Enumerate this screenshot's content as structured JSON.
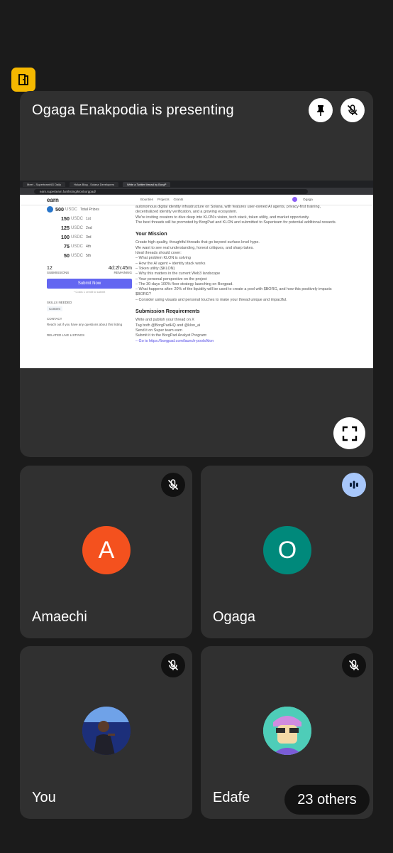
{
  "top": {
    "door_icon": "exit-door-icon",
    "door_color": "#f5b800"
  },
  "presentation": {
    "title": "Ogaga Enakpodia is presenting",
    "shared_screen": {
      "tabs": [
        "Meet - SuperteamNG Daily",
        "Holaa Blog - Solana Developers",
        "Write a Twitter thread by BorgP"
      ],
      "url": "earn.superteam.fun/listing/klonborgpad/",
      "site_logo": "earn",
      "nav_links": [
        "Bounties",
        "Projects",
        "Grants"
      ],
      "user_name": "Ogaga",
      "total_prize": "500",
      "total_prize_unit": "USDC",
      "total_prize_label": "Total Prizes",
      "prizes": [
        {
          "amount": "150",
          "unit": "USDC",
          "rank": "1st"
        },
        {
          "amount": "125",
          "unit": "USDC",
          "rank": "2nd"
        },
        {
          "amount": "100",
          "unit": "USDC",
          "rank": "3rd"
        },
        {
          "amount": "75",
          "unit": "USDC",
          "rank": "4th"
        },
        {
          "amount": "50",
          "unit": "USDC",
          "rank": "5th"
        }
      ],
      "submissions_count": "12",
      "submissions_label": "SUBMISSIONS",
      "remaining_time": "4d:2h:45m",
      "remaining_label": "REMAINING",
      "submit_label": "Submit Now",
      "credit_note": "* Costs 1 credit to submit",
      "skills_label": "SKILLS NEEDED",
      "skill": "Content",
      "contact_label": "CONTACT",
      "contact_text": "Reach out  if you have any questions about this listing",
      "related_label": "RELATED LIVE LISTINGS",
      "intro_lines": [
        "autonomous digital identity infrastructure on Solana, with features user-owned AI agents, privacy-first training,",
        "decentralized identity verification, and a growing ecosystem.",
        "We're inviting creators to dive deep into KLON's vision, tech stack, token utility, and market opportunity.",
        "The best threads will be promoted by BorgPad and KLON and submitted to Superteam for potential additional rewards."
      ],
      "mission_heading": "Your Mission",
      "mission_lines": [
        "Create high-quality, thoughtful threads that go beyond surface-level hype.",
        "We want to see real understanding, honest critiques, and sharp takes.",
        "Ideal threads should cover:",
        "– What problem KLON is solving",
        "– How the AI agent + identity stack works",
        "– Token utility ($KLON)",
        "– Why this matters in the current Web3 landscape",
        "– Your personal perspective on the project",
        "– The 30-days 100% floor strategy launching on Borgpad.",
        "– What happens after: 20% of the liquidity will be used to create a pool with $BORG, and how this positively impacts",
        "$BORG?",
        "– Consider using visuals and personal touches to make your thread unique and impactful."
      ],
      "requirements_heading": "Submission Requirements",
      "requirements_lines": [
        "Write and publish your thread on X",
        "Tag both @BorgPadHQ and @klon_ai",
        "Send it on Super team earn",
        "Submit it to the BorgPad Analyst Program:",
        "– Go to https://borgpad.com/launch-pools/klon"
      ]
    }
  },
  "participants": [
    {
      "name": "Amaechi",
      "initial": "A",
      "color": "#f4511e",
      "state": "muted"
    },
    {
      "name": "Ogaga",
      "initial": "O",
      "color": "#00897b",
      "state": "speaking"
    },
    {
      "name": "You",
      "state": "muted"
    },
    {
      "name": "Edafe",
      "state": "muted"
    }
  ],
  "others_label": "23 others"
}
